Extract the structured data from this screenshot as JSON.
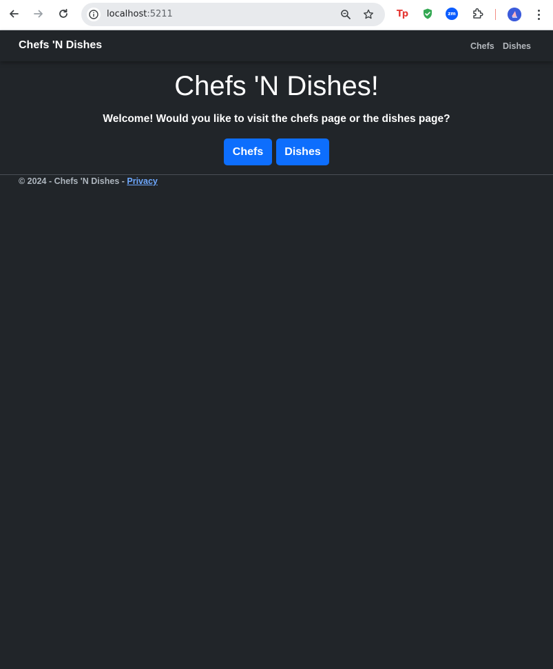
{
  "browser": {
    "url_host": "localhost",
    "url_port": ":5211"
  },
  "navbar": {
    "brand": "Chefs 'N Dishes",
    "links": [
      {
        "label": "Chefs"
      },
      {
        "label": "Dishes"
      }
    ]
  },
  "main": {
    "title": "Chefs 'N Dishes!",
    "welcome": "Welcome! Would you like to visit the chefs page or the dishes page?",
    "buttons": [
      {
        "label": "Chefs"
      },
      {
        "label": "Dishes"
      }
    ]
  },
  "footer": {
    "copyright": "© 2024 - Chefs 'N Dishes - ",
    "privacy_link": "Privacy"
  },
  "colors": {
    "page_background": "#212529",
    "primary_button": "#0d6efd",
    "link": "#6ea8fe",
    "nav_link": "#b4b8bd"
  },
  "icons": [
    "back-arrow-icon",
    "forward-arrow-icon",
    "reload-icon",
    "site-info-icon",
    "zoom-icon",
    "bookmark-star-icon",
    "tp-extension-icon",
    "shield-extension-icon",
    "zoom-extension-icon",
    "extensions-puzzle-icon",
    "profile-avatar-icon",
    "browser-menu-icon"
  ]
}
